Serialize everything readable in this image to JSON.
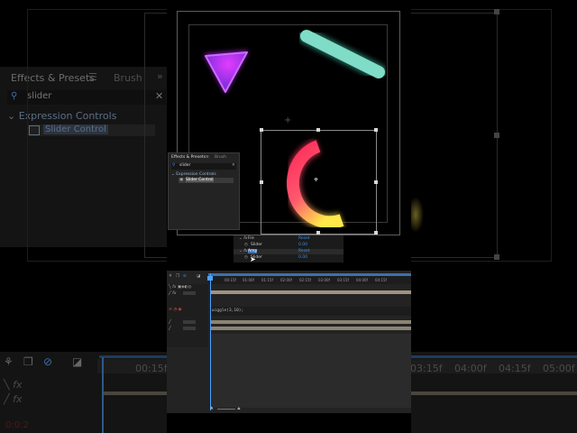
{
  "background_panel": {
    "tabs": [
      "Effects & Presets",
      "Brush"
    ],
    "search_value": "slider",
    "tree_category": "Expression Controls",
    "tree_item": "Slider Control"
  },
  "background_timeline": {
    "ruler_labels": [
      "00:15f",
      "03:15f",
      "04:00f",
      "04:15f",
      "05:00f"
    ],
    "timecode_hint": "0:0:2"
  },
  "mini_panel": {
    "tabs": [
      "Effects & Presets",
      "Brush"
    ],
    "search_value": "slider",
    "tree_category": "Expression Controls",
    "tree_item": "Slider Control"
  },
  "effect_props": {
    "rows": [
      {
        "label": "Fre",
        "value": "Reset"
      },
      {
        "label": "Slider",
        "value": "0.00"
      },
      {
        "label": "Amp",
        "value": "Reset"
      },
      {
        "label": "Slider",
        "value": "0.00"
      }
    ]
  },
  "timeline": {
    "ruler_labels": [
      "00:15f",
      "01:00f",
      "01:15f",
      "02:00f",
      "02:15f",
      "03:00f",
      "03:15f",
      "04:00f",
      "04:15f"
    ],
    "expression_text": "wiggle(3,10);"
  },
  "colors": {
    "accent_blue": "#3d8ee6",
    "playhead": "#4aa3ff",
    "shape_purple": "#b42cff",
    "shape_teal": "#6fd8c4",
    "arc_red": "#ff2a5a",
    "arc_yellow": "#ffe84a"
  }
}
